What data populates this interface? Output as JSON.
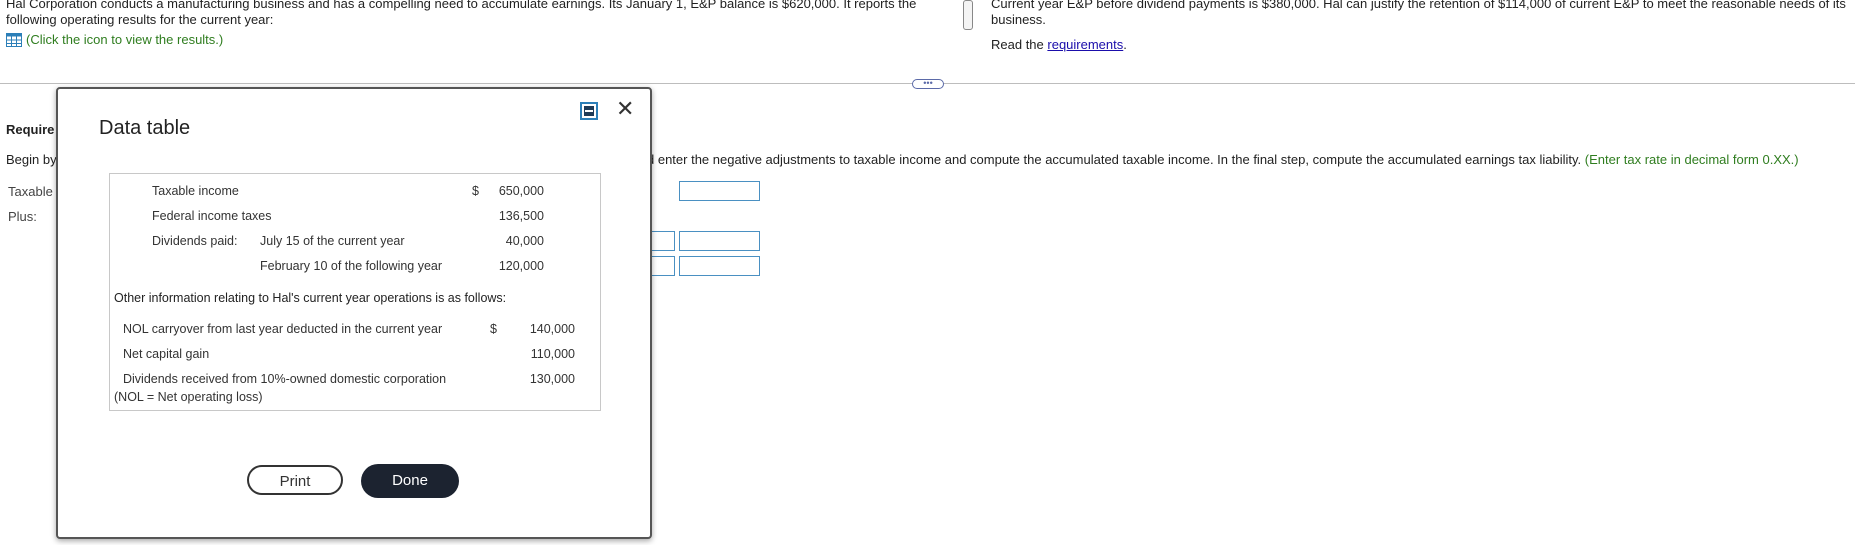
{
  "problem": {
    "text_line1": "Hal Corporation conducts a manufacturing business and has a compelling need to accumulate earnings. Its January 1, E&P balance is $620,000. It reports the",
    "text_line2": "following operating results for the current year:",
    "hint": "(Click the icon to view the results.)"
  },
  "right_pane": {
    "text_line1": "Current year E&P before dividend payments is $380,000. Hal can justify the retention of $114,000 of current E&P to meet the reasonable needs of its",
    "text_line2": "business.",
    "read_prefix": "Read the",
    "read_link": "requirements",
    "read_suffix": "."
  },
  "splitter_glyph": "•••",
  "question": {
    "requirement_label": "Require",
    "begin_text": "Begin by",
    "instruction": "d enter the negative adjustments to taxable income and compute the accumulated taxable income. In the final step, compute the accumulated earnings tax liability.",
    "instruction_hint": "(Enter tax rate in decimal form 0.XX.)",
    "taxable_label": "Taxable",
    "plus_label": "Plus:"
  },
  "modal": {
    "title": "Data table",
    "close_glyph": "✕",
    "table": {
      "rows": [
        {
          "label": "Taxable income",
          "sublabel": "",
          "currency": "$",
          "value": "650,000"
        },
        {
          "label": "Federal income taxes",
          "sublabel": "",
          "currency": "",
          "value": "136,500"
        },
        {
          "label": "Dividends paid:",
          "sublabel": "July 15 of the current year",
          "currency": "",
          "value": "40,000"
        },
        {
          "label": "",
          "sublabel": "February 10 of the following year",
          "currency": "",
          "value": "120,000"
        }
      ],
      "other_info": "Other information relating to Hal's current year operations is as follows:",
      "other_rows": [
        {
          "label": "NOL carryover from last year deducted in the current year",
          "currency": "$",
          "value": "140,000"
        },
        {
          "label": "Net capital gain",
          "currency": "",
          "value": "110,000"
        },
        {
          "label": "Dividends received from 10%-owned domestic corporation",
          "currency": "",
          "value": "130,000"
        }
      ],
      "note": "(NOL = Net operating loss)"
    },
    "print_label": "Print",
    "done_label": "Done"
  },
  "colors": {
    "accent": "#2c7fb8",
    "hint_green": "#2f7d1f",
    "link_blue": "#1a0dab",
    "done_bg": "#1c2330"
  }
}
